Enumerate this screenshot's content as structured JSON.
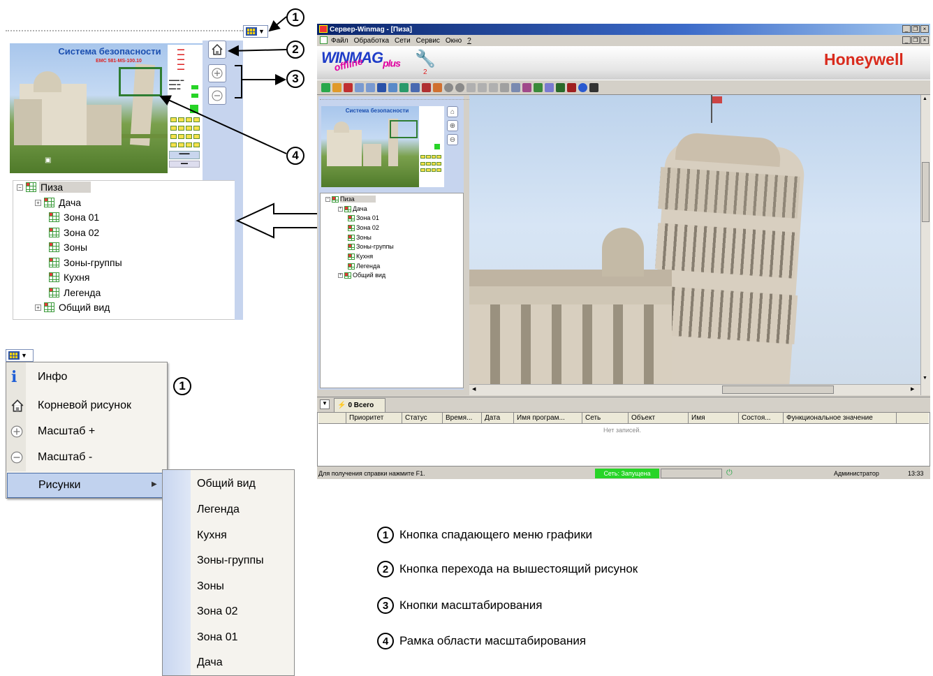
{
  "left_panel": {
    "picture_title": "Система безопасности",
    "picture_subtitle": "EMC 581-MS-100.10",
    "tree": {
      "root": "Пиза",
      "items": [
        "Дача",
        "Зона 01",
        "Зона 02",
        "Зоны",
        "Зоны-группы",
        "Кухня",
        "Легенда",
        "Общий вид"
      ]
    }
  },
  "callouts": [
    "1",
    "2",
    "3",
    "4"
  ],
  "dropdown_menu": {
    "callout": "1",
    "items": [
      {
        "label": "Инфо",
        "icon": "info-icon"
      },
      {
        "label": "Корневой рисунок",
        "icon": "home-icon"
      },
      {
        "label": "Масштаб +",
        "icon": "zoom-in-icon"
      },
      {
        "label": "Масштаб -",
        "icon": "zoom-out-icon"
      },
      {
        "label": "Рисунки",
        "icon": "submenu-arrow-icon"
      }
    ],
    "submenu": [
      "Общий вид",
      "Легенда",
      "Кухня",
      "Зоны-группы",
      "Зоны",
      "Зона 02",
      "Зона 01",
      "Дача"
    ]
  },
  "window": {
    "title": "Сервер-Winmag - [Пиза]",
    "menu": [
      "Файл",
      "Обработка",
      "Сети",
      "Сервис",
      "Окно",
      "?"
    ],
    "logo_main": "WINMAG",
    "logo_plus": "plus",
    "logo_offline": "offline",
    "logo_number": "2",
    "brand": "Honeywell",
    "inner_tree": {
      "root": "Пиза",
      "items": [
        "Дача",
        "Зона 01",
        "Зона 02",
        "Зоны",
        "Зоны-группы",
        "Кухня",
        "Легенда",
        "Общий вид"
      ]
    },
    "tab_label": "0 Всего",
    "columns": [
      "Приоритет",
      "Статус",
      "Время...",
      "Дата",
      "Имя програм...",
      "Сеть",
      "Объект",
      "Имя",
      "Состоя...",
      "Функциональное значение"
    ],
    "empty_text": "Нет записей.",
    "status_help": "Для получения справки нажмите F1.",
    "status_net": "Сеть: Запущена",
    "status_user": "Администратор",
    "status_time": "13:33"
  },
  "legend": [
    {
      "num": "1",
      "text": "Кнопка спадающего меню графики"
    },
    {
      "num": "2",
      "text": "Кнопка перехода на вышестоящий рисунок"
    },
    {
      "num": "3",
      "text": "Кнопки масштабирования"
    },
    {
      "num": "4",
      "text": "Рамка области масштабирования"
    }
  ],
  "colors": {
    "accent": "#c1d2ee",
    "brand": "#d92a1c",
    "net_ok": "#27d427",
    "frame": "#2e7d32"
  }
}
